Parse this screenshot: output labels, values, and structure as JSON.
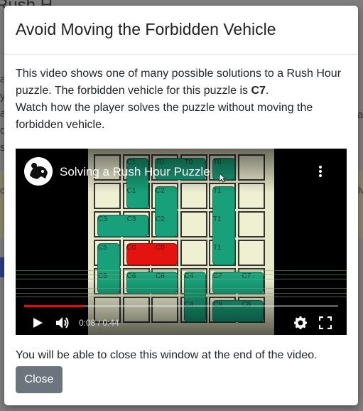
{
  "background": {
    "title_fragment": "Rush H",
    "left_letters": [
      "a",
      "y",
      "ai",
      "or",
      "s"
    ],
    "right_letters": [
      "a"
    ],
    "left_strip_letter": "cl",
    "right_strip_letter": "lv"
  },
  "modal": {
    "title": "Avoid Moving the Forbidden Vehicle",
    "description_part1": "This video shows one of many possible solutions to a Rush Hour puzzle. The forbidden vehicle for this puzzle is ",
    "forbidden_vehicle": "C7",
    "description_part2": ".",
    "description_line2": "Watch how the player solves the puzzle without moving the forbidden vehicle.",
    "footer_text": "You will be able to close this window at the end of the video.",
    "close_label": "Close"
  },
  "video": {
    "title": "Solving a Rush Hour Puzzle",
    "current_time": "0:08",
    "duration": "0:44",
    "time_separator": " / ",
    "progress_fraction": 0.19,
    "board_labels": [
      "C1",
      "T0",
      "T0",
      "T0",
      "C1",
      "C2",
      "T1",
      "C3",
      "C3",
      "C2",
      "T1",
      "C5",
      "C0",
      "C0",
      "T1",
      "C5",
      "C6",
      "C6",
      "C4",
      "C7",
      "C7",
      "C4",
      "C8",
      "C8"
    ]
  },
  "colors": {
    "modal_bg": "#ffffff",
    "close_btn_bg": "#6c757d",
    "vehicle_green": "#17a079",
    "vehicle_red": "#e3140f",
    "progress_red": "#ff0000"
  }
}
